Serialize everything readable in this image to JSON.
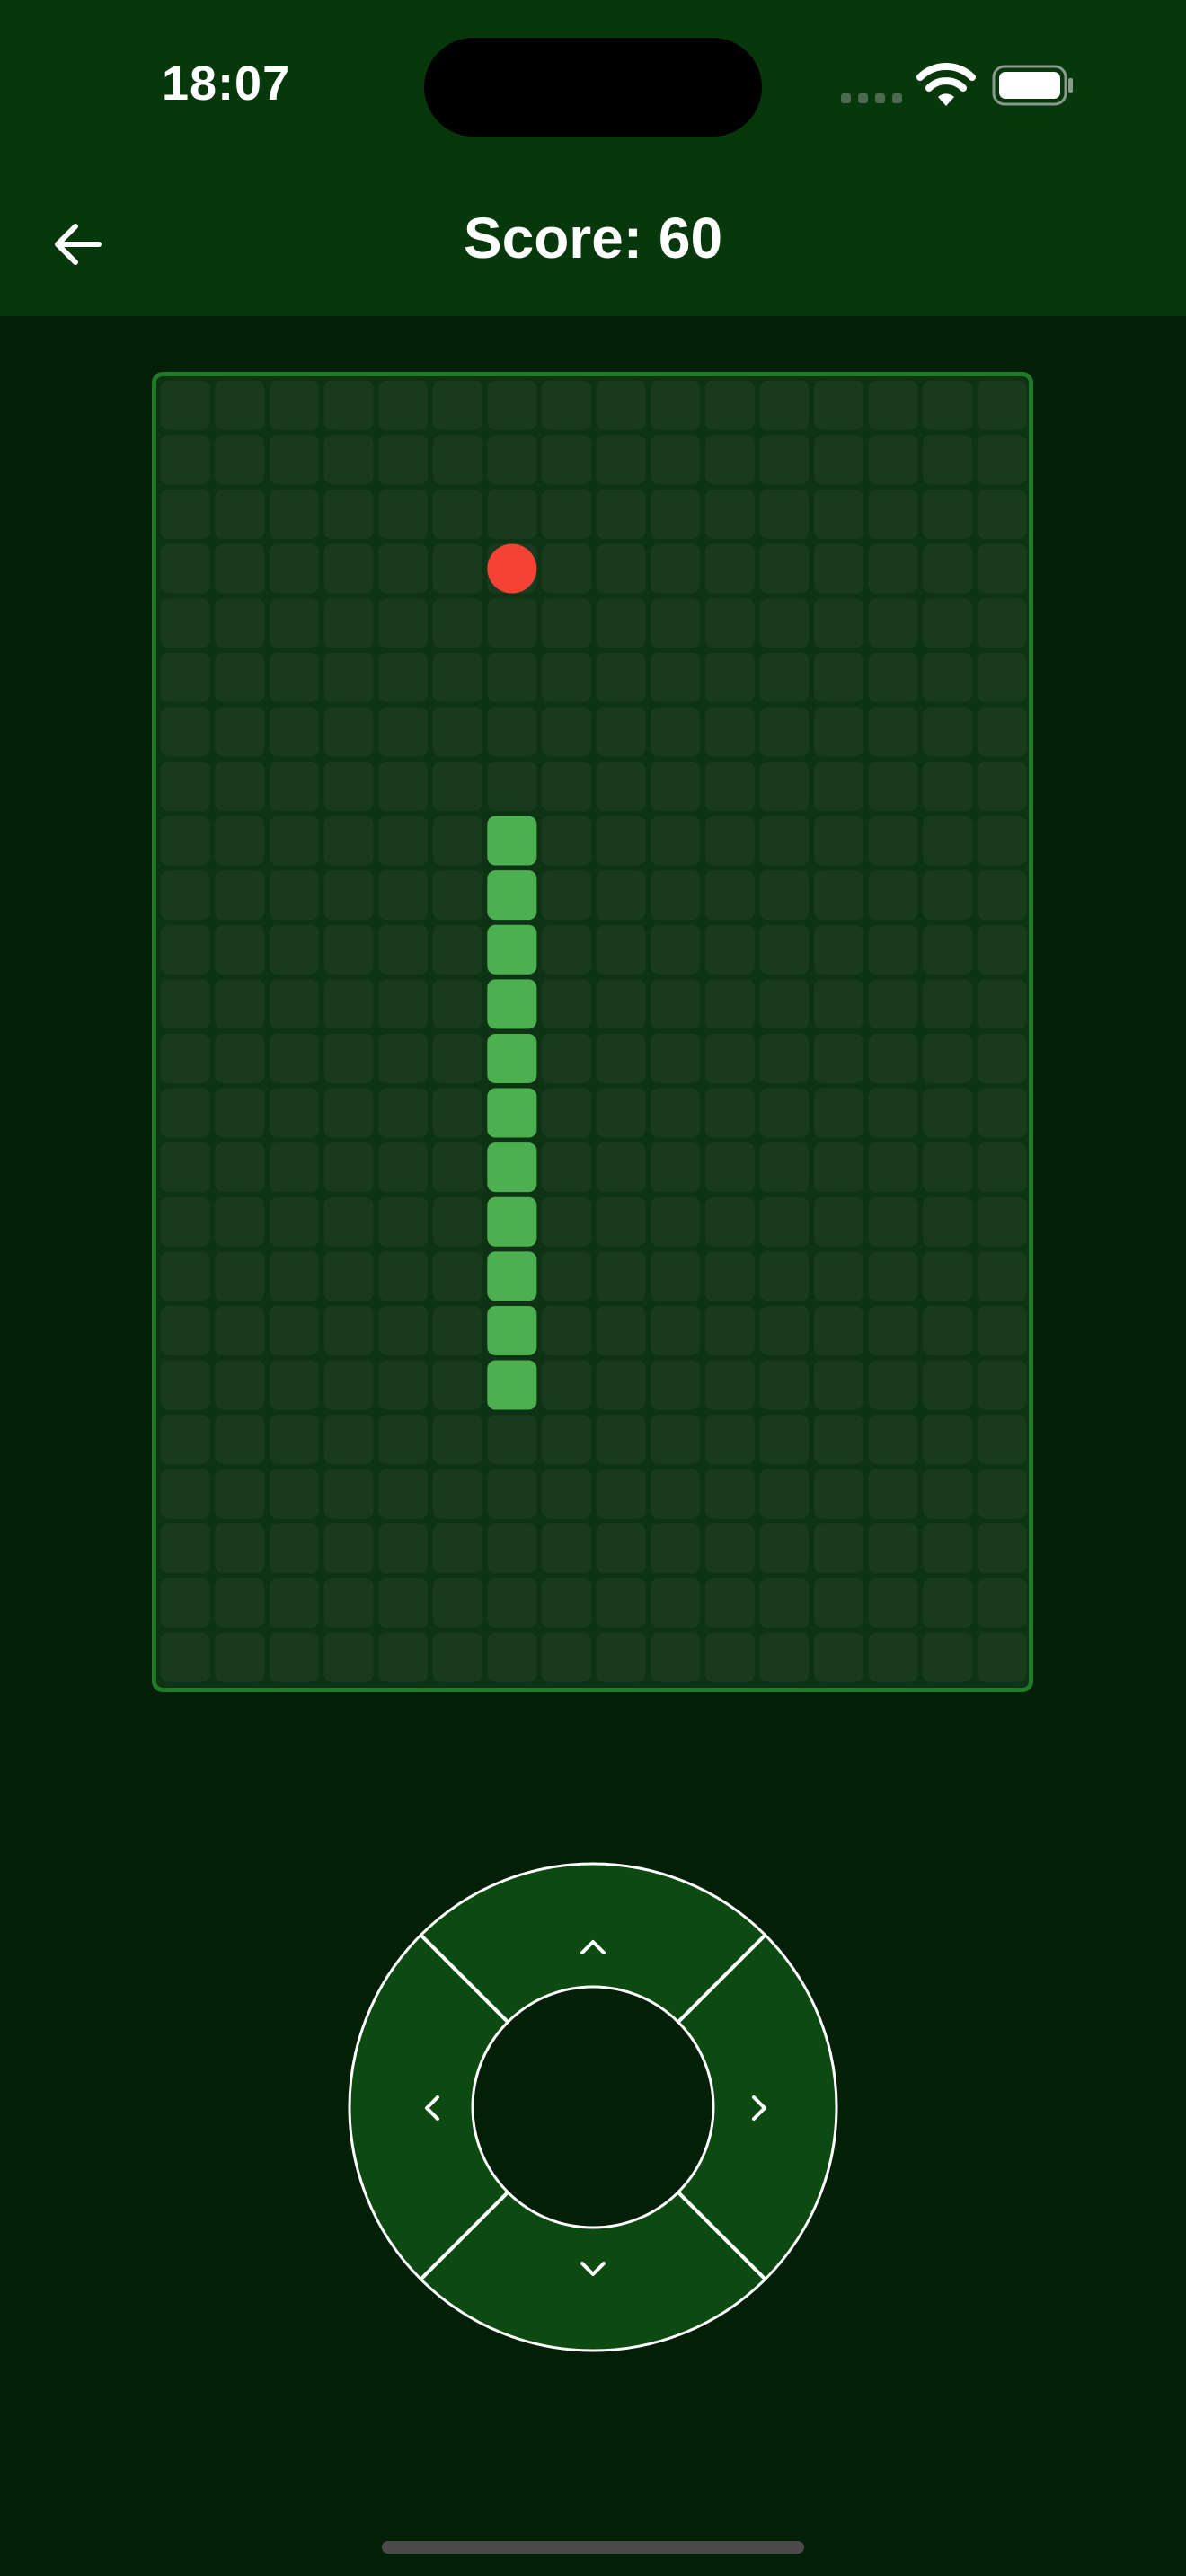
{
  "status_bar": {
    "time": "18:07",
    "icons": [
      "cellular-signal-icon",
      "wifi-icon",
      "battery-icon"
    ]
  },
  "header": {
    "back_icon": "arrow-left-icon",
    "title": "Score: 60"
  },
  "board": {
    "columns": 16,
    "rows": 24,
    "food": {
      "col": 6,
      "row": 3
    },
    "snake": [
      {
        "col": 6,
        "row": 8
      },
      {
        "col": 6,
        "row": 9
      },
      {
        "col": 6,
        "row": 10
      },
      {
        "col": 6,
        "row": 11
      },
      {
        "col": 6,
        "row": 12
      },
      {
        "col": 6,
        "row": 13
      },
      {
        "col": 6,
        "row": 14
      },
      {
        "col": 6,
        "row": 15
      },
      {
        "col": 6,
        "row": 16
      },
      {
        "col": 6,
        "row": 17
      },
      {
        "col": 6,
        "row": 18
      }
    ],
    "colors": {
      "background": "#0e3314",
      "border": "#1f7a29",
      "cell": "#1a3a1f",
      "snake": "#4caf50",
      "food": "#f44336"
    }
  },
  "controls": {
    "up_icon": "chevron-up-icon",
    "down_icon": "chevron-down-icon",
    "left_icon": "chevron-left-icon",
    "right_icon": "chevron-right-icon",
    "colors": {
      "segment": "#0d4a12",
      "center": "#041f07",
      "outline": "#ffffff"
    }
  }
}
